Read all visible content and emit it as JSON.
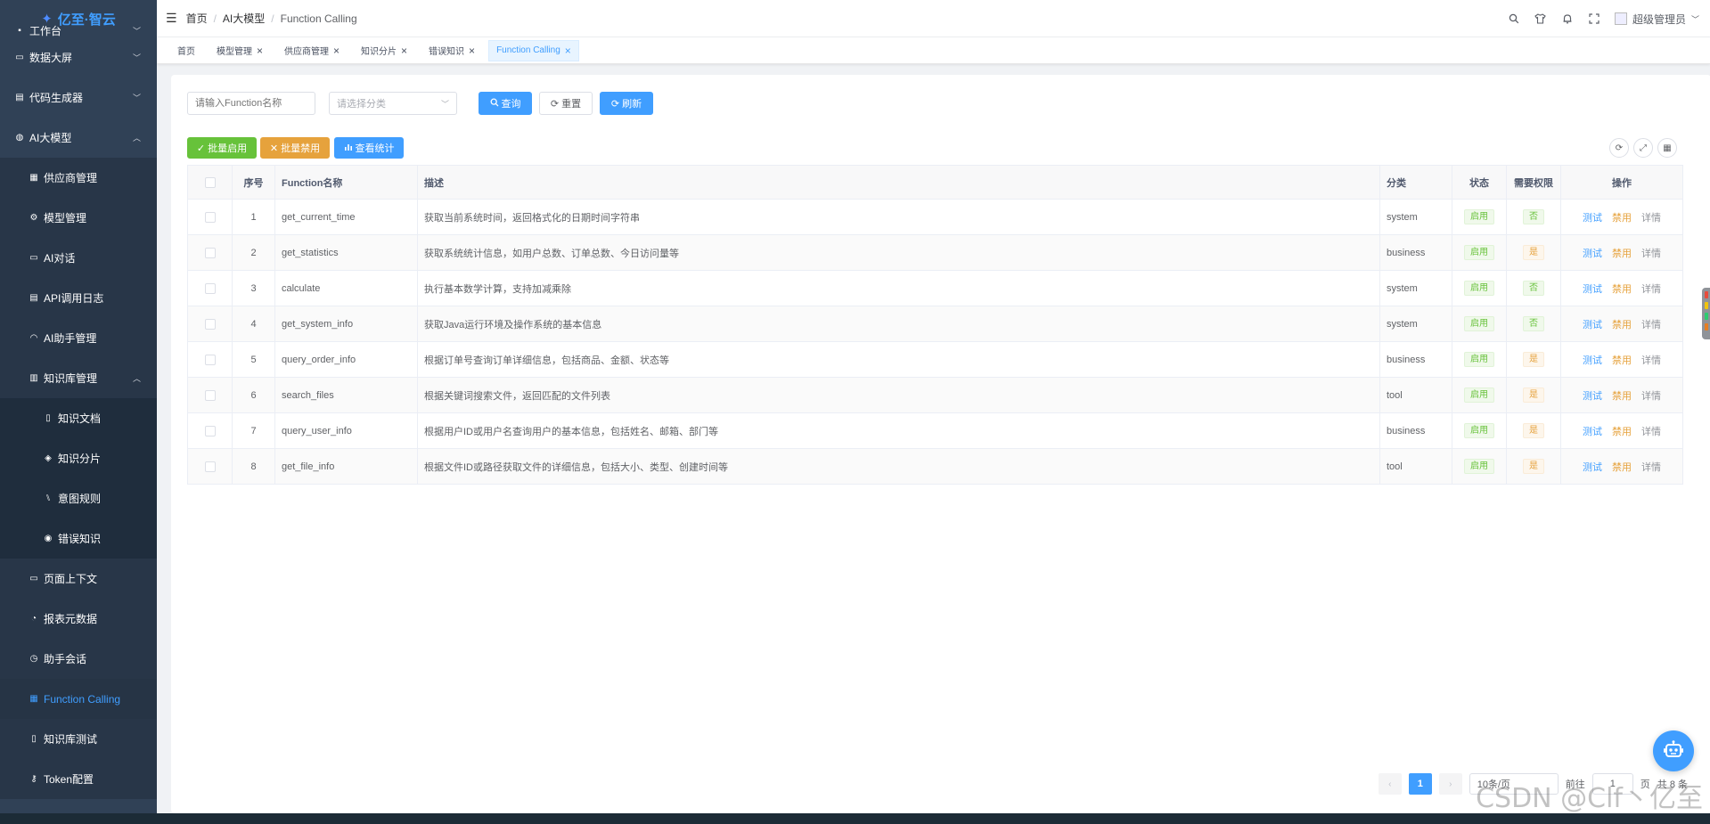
{
  "app": {
    "logo_text": "亿至·智云"
  },
  "sidebar": {
    "partial_item": "工作台",
    "items": [
      {
        "label": "数据大屏",
        "icon": "monitor-icon",
        "chevron": "﹀",
        "level": 0
      },
      {
        "label": "代码生成器",
        "icon": "code-icon",
        "chevron": "﹀",
        "level": 0
      },
      {
        "label": "AI大模型",
        "icon": "ai-icon",
        "chevron": "︿",
        "level": 0
      },
      {
        "label": "供应商管理",
        "icon": "list-icon",
        "level": 1
      },
      {
        "label": "模型管理",
        "icon": "gear-icon",
        "level": 1
      },
      {
        "label": "AI对话",
        "icon": "chat-icon",
        "level": 1
      },
      {
        "label": "API调用日志",
        "icon": "log-icon",
        "level": 1
      },
      {
        "label": "AI助手管理",
        "icon": "headset-icon",
        "level": 1
      },
      {
        "label": "知识库管理",
        "icon": "book-icon",
        "chevron": "︿",
        "level": 1
      },
      {
        "label": "知识文档",
        "icon": "document-icon",
        "level": 2
      },
      {
        "label": "知识分片",
        "icon": "layers-icon",
        "level": 2
      },
      {
        "label": "意图规则",
        "icon": "rule-icon",
        "level": 2
      },
      {
        "label": "错误知识",
        "icon": "warning-icon",
        "level": 2
      },
      {
        "label": "页面上下文",
        "icon": "page-icon",
        "level": 1
      },
      {
        "label": "报表元数据",
        "icon": "chart-icon",
        "level": 1
      },
      {
        "label": "助手会话",
        "icon": "clock-icon",
        "level": 1
      },
      {
        "label": "Function Calling",
        "icon": "function-icon",
        "level": 1,
        "active": true
      },
      {
        "label": "知识库测试",
        "icon": "flask-icon",
        "level": 1
      },
      {
        "label": "Token配置",
        "icon": "key-icon",
        "level": 1
      }
    ]
  },
  "navbar": {
    "breadcrumb": [
      "首页",
      "AI大模型",
      "Function Calling"
    ],
    "user_name": "超级管理员"
  },
  "tags": [
    {
      "label": "首页",
      "closable": false,
      "active": false
    },
    {
      "label": "模型管理",
      "closable": true,
      "active": false
    },
    {
      "label": "供应商管理",
      "closable": true,
      "active": false
    },
    {
      "label": "知识分片",
      "closable": true,
      "active": false
    },
    {
      "label": "错误知识",
      "closable": true,
      "active": false
    },
    {
      "label": "Function Calling",
      "closable": true,
      "active": true
    }
  ],
  "search": {
    "name_placeholder": "请输入Function名称",
    "category_placeholder": "请选择分类",
    "query_label": "查询",
    "reset_label": "重置",
    "refresh_label": "刷新"
  },
  "toolbar": {
    "batch_enable": "批量启用",
    "batch_disable": "批量禁用",
    "view_stats": "查看统计"
  },
  "table": {
    "headers": {
      "index": "序号",
      "name": "Function名称",
      "desc": "描述",
      "category": "分类",
      "status": "状态",
      "permission": "需要权限",
      "action": "操作"
    },
    "action_labels": {
      "test": "测试",
      "disable": "禁用",
      "detail": "详情"
    },
    "rows": [
      {
        "index": "1",
        "name": "get_current_time",
        "desc": "获取当前系统时间，返回格式化的日期时间字符串",
        "category": "system",
        "status": "启用",
        "permission": "否"
      },
      {
        "index": "2",
        "name": "get_statistics",
        "desc": "获取系统统计信息，如用户总数、订单总数、今日访问量等",
        "category": "business",
        "status": "启用",
        "permission": "是"
      },
      {
        "index": "3",
        "name": "calculate",
        "desc": "执行基本数学计算，支持加减乘除",
        "category": "system",
        "status": "启用",
        "permission": "否"
      },
      {
        "index": "4",
        "name": "get_system_info",
        "desc": "获取Java运行环境及操作系统的基本信息",
        "category": "system",
        "status": "启用",
        "permission": "否"
      },
      {
        "index": "5",
        "name": "query_order_info",
        "desc": "根据订单号查询订单详细信息，包括商品、金额、状态等",
        "category": "business",
        "status": "启用",
        "permission": "是"
      },
      {
        "index": "6",
        "name": "search_files",
        "desc": "根据关键词搜索文件，返回匹配的文件列表",
        "category": "tool",
        "status": "启用",
        "permission": "是"
      },
      {
        "index": "7",
        "name": "query_user_info",
        "desc": "根据用户ID或用户名查询用户的基本信息，包括姓名、邮箱、部门等",
        "category": "business",
        "status": "启用",
        "permission": "是"
      },
      {
        "index": "8",
        "name": "get_file_info",
        "desc": "根据文件ID或路径获取文件的详细信息，包括大小、类型、创建时间等",
        "category": "tool",
        "status": "启用",
        "permission": "是"
      }
    ]
  },
  "pagination": {
    "current_page": "1",
    "page_size": "10条/页",
    "goto_label": "前往",
    "goto_value": "1",
    "page_unit": "页",
    "total": "共 8 条"
  },
  "watermark": "CSDN @Clf丶亿至",
  "colors": {
    "primary": "#409eff",
    "success": "#67c23a",
    "warning": "#e6a23c",
    "sidebar_bg": "#304156"
  }
}
